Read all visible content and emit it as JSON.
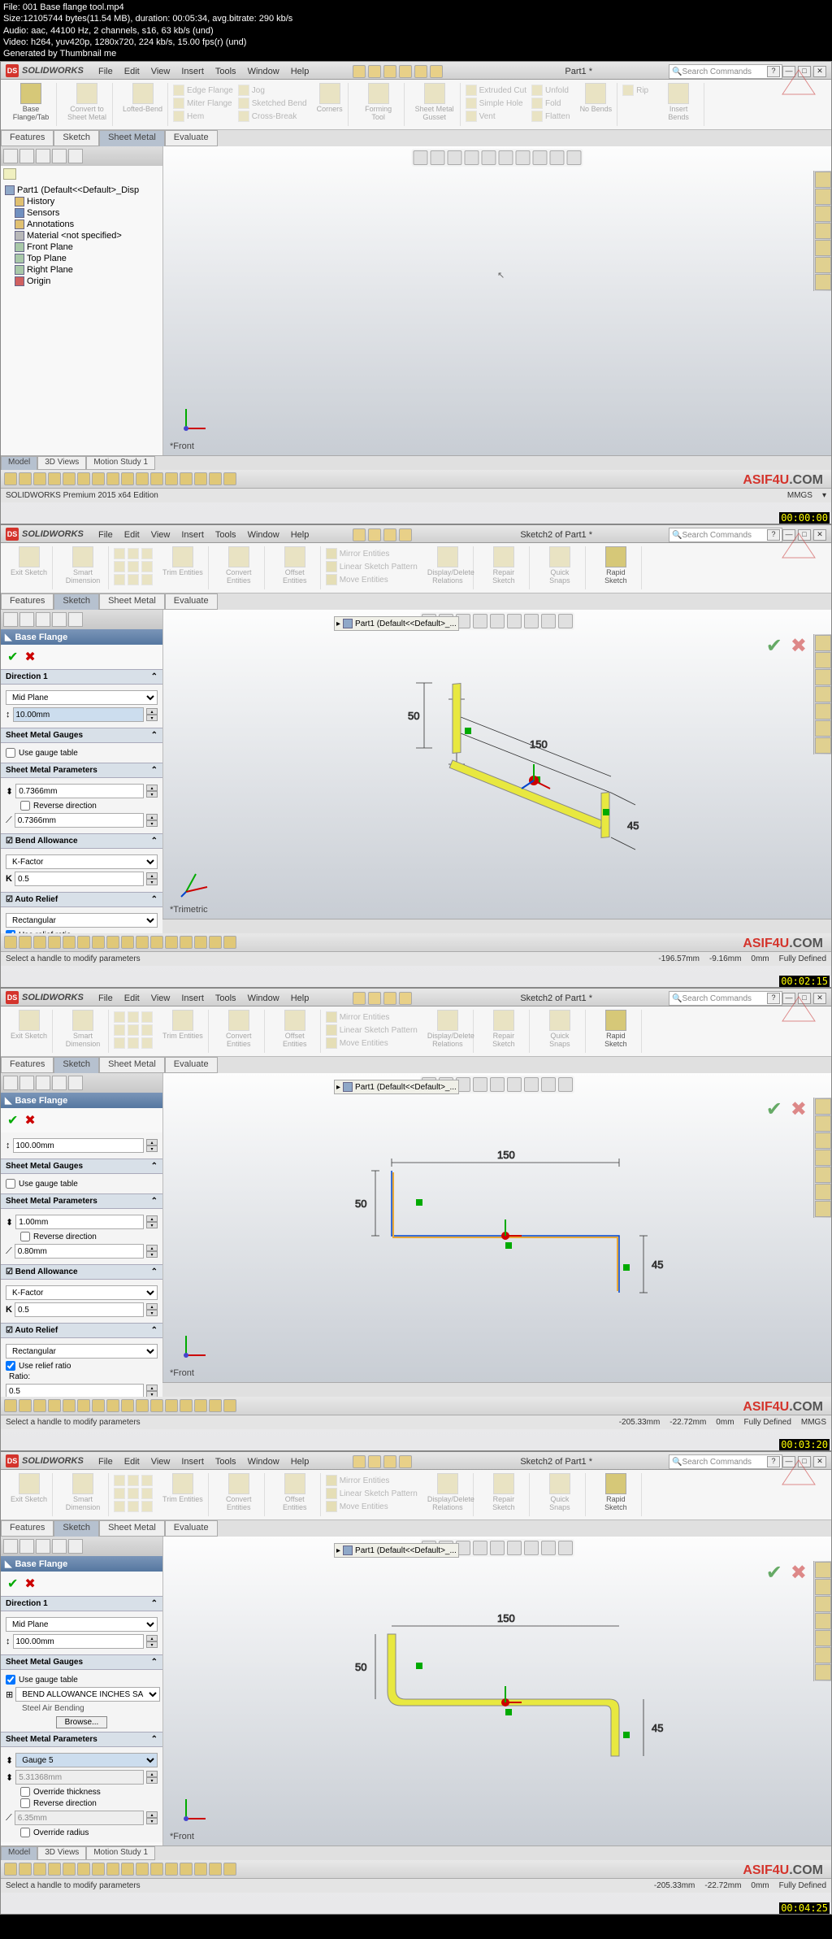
{
  "video": {
    "file": "File: 001 Base flange tool.mp4",
    "size": "Size:12105744 bytes(11.54 MB), duration: 00:05:34, avg.bitrate: 290 kb/s",
    "audio": "Audio: aac, 44100 Hz, 2 channels, s16, 63 kb/s (und)",
    "vid": "Video: h264, yuv420p, 1280x720, 224 kb/s, 15.00 fps(r) (und)",
    "gen": "Generated by Thumbnail me"
  },
  "app": "SOLIDWORKS",
  "menu": [
    "File",
    "Edit",
    "View",
    "Insert",
    "Tools",
    "Window",
    "Help"
  ],
  "search": "Search Commands",
  "f1": {
    "doc": "Part1 *",
    "tabs": [
      "Features",
      "Sketch",
      "Sheet Metal",
      "Evaluate"
    ],
    "active_tab": "Sheet Metal",
    "ribbon": {
      "big": [
        "Base Flange/Tab",
        "Convert to Sheet Metal",
        "Lofted-Bend",
        "Corners",
        "Forming Tool",
        "Sheet Metal Gusset",
        "No Bends",
        "Insert Bends"
      ],
      "items": [
        "Edge Flange",
        "Miter Flange",
        "Hem",
        "Jog",
        "Sketched Bend",
        "Cross-Break",
        "Extruded Cut",
        "Simple Hole",
        "Vent",
        "Unfold",
        "Fold",
        "Flatten",
        "Rip"
      ]
    },
    "tree": [
      "Part1 (Default<<Default>_Disp",
      "History",
      "Sensors",
      "Annotations",
      "Material <not specified>",
      "Front Plane",
      "Top Plane",
      "Right Plane",
      "Origin"
    ],
    "view": "*Front",
    "btabs": [
      "Model",
      "3D Views",
      "Motion Study 1"
    ],
    "status": "SOLIDWORKS Premium 2015 x64 Edition",
    "units": "MMGS",
    "ts": "00:00:00"
  },
  "f2": {
    "doc": "Sketch2 of Part1 *",
    "tabs": [
      "Features",
      "Sketch",
      "Sheet Metal",
      "Evaluate"
    ],
    "active_tab": "Sketch",
    "ribbon_big": [
      "Exit Sketch",
      "Smart Dimension",
      "Trim Entities",
      "Convert Entities",
      "Offset Entities",
      "Display/Delete Relations",
      "Repair Sketch",
      "Quick Snaps",
      "Rapid Sketch"
    ],
    "ribbon_items": [
      "Mirror Entities",
      "Linear Sketch Pattern",
      "Move Entities"
    ],
    "fly": "Part1 (Default<<Default>_...",
    "pm": {
      "title": "Base Flange",
      "s1": "Direction 1",
      "dir": "Mid Plane",
      "d1": "10.00mm",
      "d1_sel": "mm",
      "s2": "Sheet Metal Gauges",
      "gauge_ck": "Use gauge table",
      "s3": "Sheet Metal Parameters",
      "t1": "0.7366mm",
      "rev": "Reverse direction",
      "t2": "0.7366mm",
      "s4": "Bend Allowance",
      "ba": "K-Factor",
      "k": "0.5",
      "k_lbl": "K",
      "s5": "Auto Relief",
      "relief": "Rectangular",
      "use_relief": "Use relief ratio"
    },
    "view": "*Trimetric",
    "dims": {
      "a": "50",
      "b": "150",
      "c": "45"
    },
    "status": "Select a handle to modify parameters",
    "coords": [
      "-196.57mm",
      "-9.16mm",
      "0mm",
      "Fully Defined"
    ],
    "ts": "00:02:15"
  },
  "f3": {
    "doc": "Sketch2 of Part1 *",
    "pm": {
      "title": "Base Flange",
      "d1_val": "100.00mm",
      "s2": "Sheet Metal Gauges",
      "gauge_ck": "Use gauge table",
      "s3": "Sheet Metal Parameters",
      "t1": "1.00mm",
      "rev": "Reverse direction",
      "t2": "0.80mm",
      "s4": "Bend Allowance",
      "ba": "K-Factor",
      "k": "0.5",
      "k_lbl": "K",
      "s5": "Auto Relief",
      "relief": "Rectangular",
      "use_relief": "Use relief ratio",
      "ratio_lbl": "Ratio:",
      "ratio": "0.5"
    },
    "view": "*Front",
    "dims": {
      "a": "50",
      "b": "150",
      "c": "45"
    },
    "status": "Select a handle to modify parameters",
    "coords": [
      "-205.33mm",
      "-22.72mm",
      "0mm",
      "Fully Defined"
    ],
    "units": "MMGS",
    "ts": "00:03:20"
  },
  "f4": {
    "doc": "Sketch2 of Part1 *",
    "pm": {
      "title": "Base Flange",
      "s1": "Direction 1",
      "dir": "Mid Plane",
      "d1": "100.00mm",
      "s2": "Sheet Metal Gauges",
      "gauge_ck": "Use gauge table",
      "gauge_sel": "BEND ALLOWANCE INCHES SA",
      "process": "Steel Air Bending",
      "browse": "Browse...",
      "s3": "Sheet Metal Parameters",
      "gauge_num": "Gauge 5",
      "t1": "5.31368mm",
      "ov_t": "Override thickness",
      "rev": "Reverse direction",
      "r1": "6.35mm",
      "ov_r": "Override radius"
    },
    "view": "*Front",
    "dims": {
      "a": "50",
      "b": "150",
      "c": "45"
    },
    "status": "Select a handle to modify parameters",
    "coords": [
      "-205.33mm",
      "-22.72mm",
      "0mm",
      "Fully Defined"
    ],
    "ts": "00:04:25"
  },
  "wm1": "ASIF4U",
  "wm2": ".COM"
}
